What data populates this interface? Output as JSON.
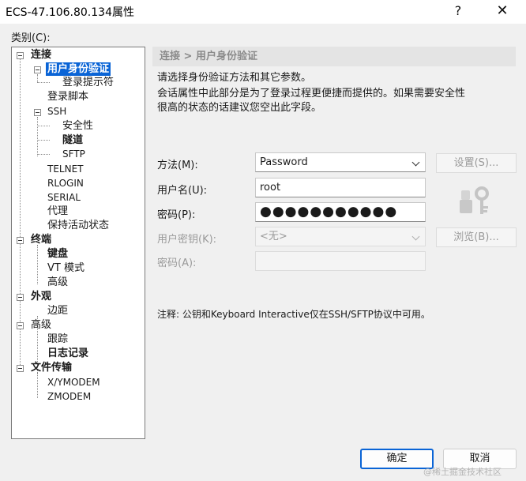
{
  "window": {
    "title": "ECS-47.106.80.134属性",
    "help_glyph": "?",
    "close_glyph": "✕"
  },
  "tree": {
    "label": "类别(C):",
    "items": [
      {
        "label": "连接"
      },
      {
        "label": "用户身份验证"
      },
      {
        "label": "登录提示符"
      },
      {
        "label": "登录脚本"
      },
      {
        "label": "SSH"
      },
      {
        "label": "安全性"
      },
      {
        "label": "隧道"
      },
      {
        "label": "SFTP"
      },
      {
        "label": "TELNET"
      },
      {
        "label": "RLOGIN"
      },
      {
        "label": "SERIAL"
      },
      {
        "label": "代理"
      },
      {
        "label": "保持活动状态"
      },
      {
        "label": "终端"
      },
      {
        "label": "键盘"
      },
      {
        "label": "VT 模式"
      },
      {
        "label": "高级"
      },
      {
        "label": "外观"
      },
      {
        "label": "边距"
      },
      {
        "label": "高级"
      },
      {
        "label": "跟踪"
      },
      {
        "label": "日志记录"
      },
      {
        "label": "文件传输"
      },
      {
        "label": "X/YMODEM"
      },
      {
        "label": "ZMODEM"
      }
    ]
  },
  "panel": {
    "header": "连接 > 用户身份验证",
    "desc1": "请选择身份验证方法和其它参数。",
    "desc2": "会话属性中此部分是为了登录过程更便捷而提供的。如果需要安全性",
    "desc3": "很高的状态的话建议您空出此字段。",
    "method_label": "方法(M):",
    "method_value": "Password",
    "settings_button": "设置(S)...",
    "username_label": "用户名(U):",
    "username_value": "root",
    "password_label": "密码(P):",
    "password_value": "●●●●●●●●●●●",
    "userkey_label": "用户密钥(K):",
    "userkey_value": "<无>",
    "browse_button": "浏览(B)...",
    "passphrase_label": "密码(A):",
    "note": "注释: 公钥和Keyboard Interactive仅在SSH/SFTP协议中可用。"
  },
  "buttons": {
    "ok": "确定",
    "cancel": "取消"
  },
  "watermark": "@稀土掘金技术社区",
  "colors": {
    "selection": "#0a64d6",
    "header_bg": "#e4e4e4",
    "dialog_bg": "#f0f0f0"
  }
}
